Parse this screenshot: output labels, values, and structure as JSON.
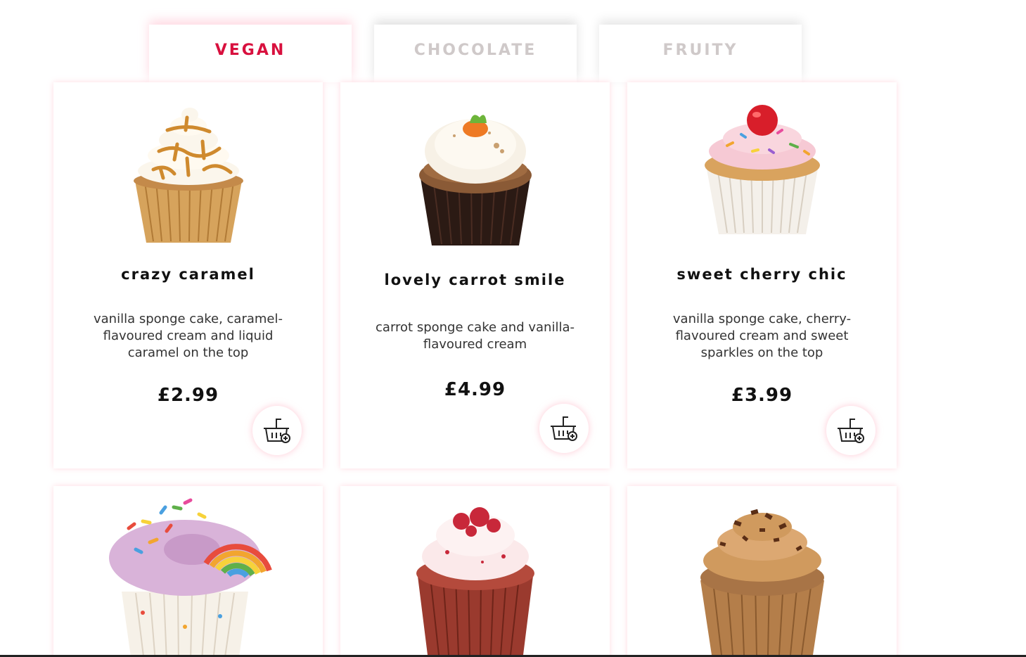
{
  "tabs": [
    {
      "label": "VEGAN",
      "active": true
    },
    {
      "label": "CHOCOLATE",
      "active": false
    },
    {
      "label": "FRUITY",
      "active": false
    }
  ],
  "colors": {
    "accent": "#d8103e",
    "inactive_tab": "#cfc9c9",
    "text_dark": "#111111",
    "shadow_pink": "#ffafbe"
  },
  "products": [
    {
      "name": "crazy caramel",
      "description": "vanilla sponge cake, caramel-flavoured cream and liquid caramel on the top",
      "price": "£2.99",
      "icon": "cart-add-icon"
    },
    {
      "name": "lovely carrot smile",
      "description": "carrot sponge cake and vanilla-flavoured cream",
      "price": "£4.99",
      "icon": "cart-add-icon"
    },
    {
      "name": "sweet cherry chic",
      "description": "vanilla sponge cake, cherry-flavoured cream and sweet sparkles on the top",
      "price": "£3.99",
      "icon": "cart-add-icon"
    }
  ]
}
